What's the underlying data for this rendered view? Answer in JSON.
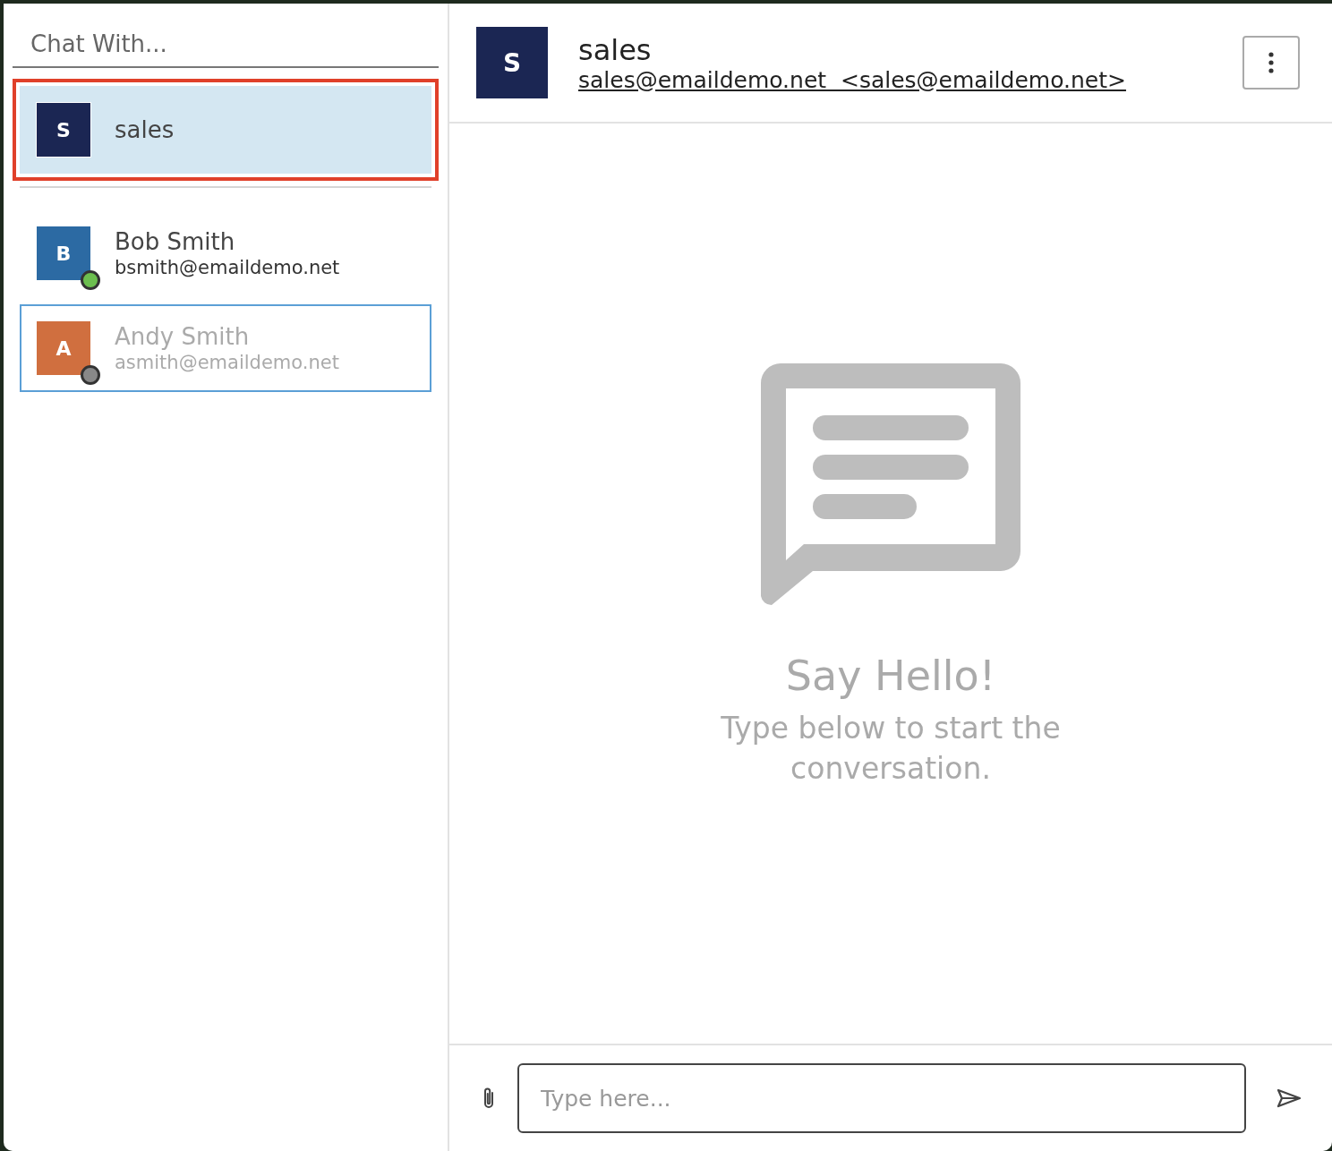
{
  "sidebar": {
    "search": {
      "placeholder": "Chat With..."
    },
    "contacts": [
      {
        "avatar": {
          "initial": "S",
          "color": "#1b2653"
        },
        "name": "sales",
        "selected": true,
        "focused": false,
        "offline": false
      },
      {
        "avatar": {
          "initial": "B",
          "color": "#2c6aa3"
        },
        "status": {
          "color": "#6cbf4f"
        },
        "name": "Bob Smith",
        "email": "bsmith@emaildemo.net",
        "selected": false,
        "focused": false,
        "offline": false
      },
      {
        "avatar": {
          "initial": "A",
          "color": "#d06f3f"
        },
        "status": {
          "color": "#888888"
        },
        "name": "Andy Smith",
        "email": "asmith@emaildemo.net",
        "selected": false,
        "focused": true,
        "offline": true
      }
    ]
  },
  "chat": {
    "header": {
      "initial": "S",
      "name": "sales",
      "address": "sales@emaildemo.net  <sales@emaildemo.net>"
    },
    "empty": {
      "title": "Say Hello!",
      "text": "Type below to start the conversation."
    },
    "composer": {
      "placeholder": "Type here..."
    }
  }
}
